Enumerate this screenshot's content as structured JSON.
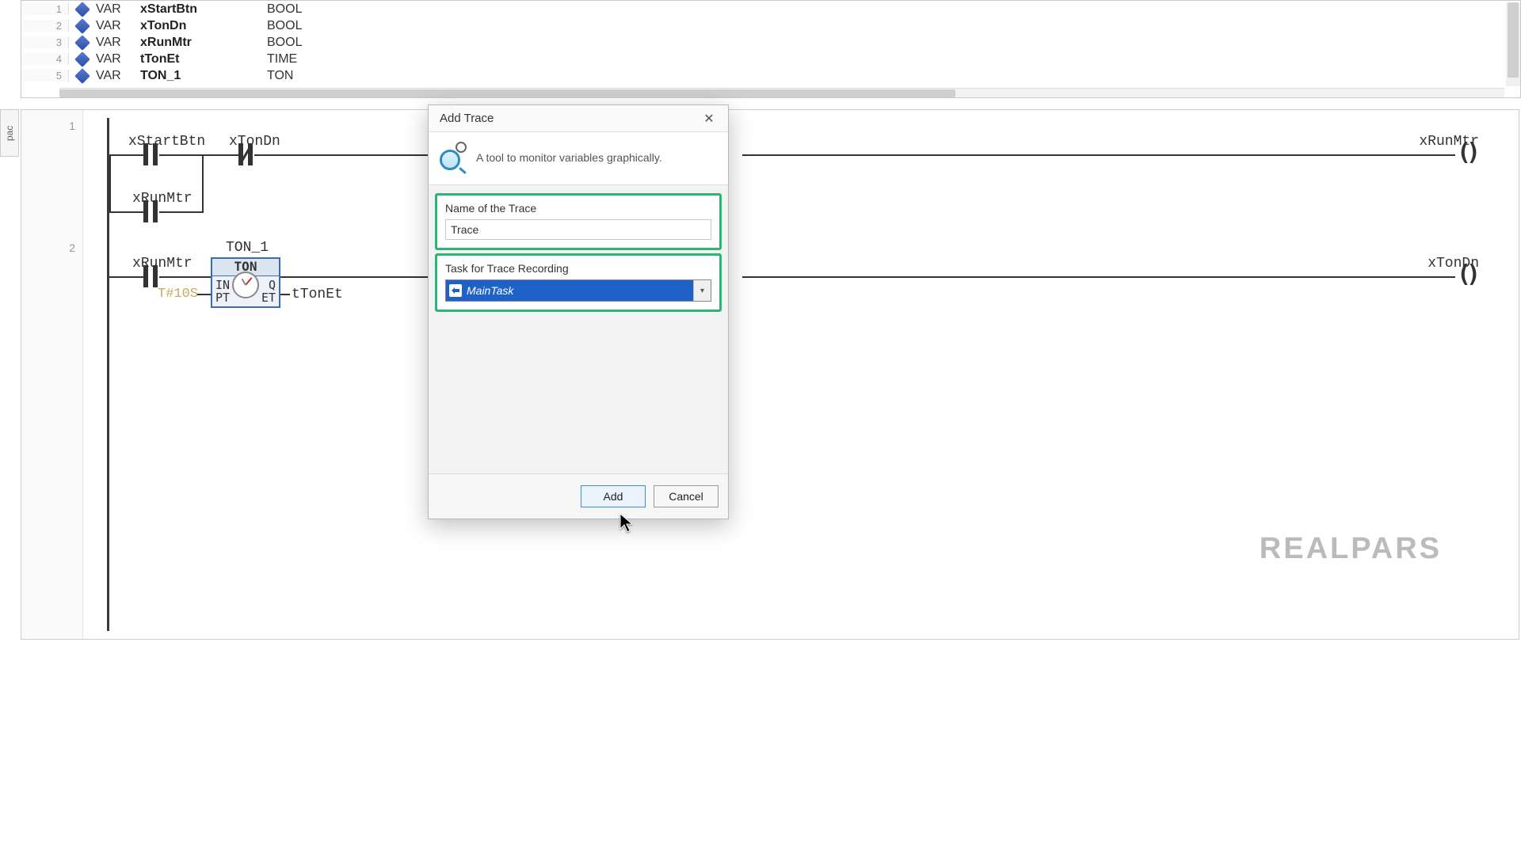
{
  "declarations": [
    {
      "line": 1,
      "kind": "VAR",
      "name": "xStartBtn",
      "type": "BOOL"
    },
    {
      "line": 2,
      "kind": "VAR",
      "name": "xTonDn",
      "type": "BOOL"
    },
    {
      "line": 3,
      "kind": "VAR",
      "name": "xRunMtr",
      "type": "BOOL"
    },
    {
      "line": 4,
      "kind": "VAR",
      "name": "tTonEt",
      "type": "TIME"
    },
    {
      "line": 5,
      "kind": "VAR",
      "name": "TON_1",
      "type": "TON"
    }
  ],
  "side_tab": "pac",
  "rungs": {
    "r1": "1",
    "r2": "2"
  },
  "labels": {
    "xStartBtn": "xStartBtn",
    "xTonDn": "xTonDn",
    "xRunMtr": "xRunMtr",
    "TON_1": "TON_1",
    "TON": "TON",
    "IN": "IN",
    "Q": "Q",
    "PT": "PT",
    "ET": "ET",
    "tTonEt": "tTonEt",
    "t10s": "T#10S"
  },
  "dialog": {
    "title": "Add Trace",
    "description": "A tool to monitor variables graphically.",
    "name_label": "Name of the Trace",
    "name_value": "Trace",
    "task_label": "Task for Trace Recording",
    "task_value": "MainTask",
    "add": "Add",
    "cancel": "Cancel"
  },
  "watermark": "REALPARS"
}
